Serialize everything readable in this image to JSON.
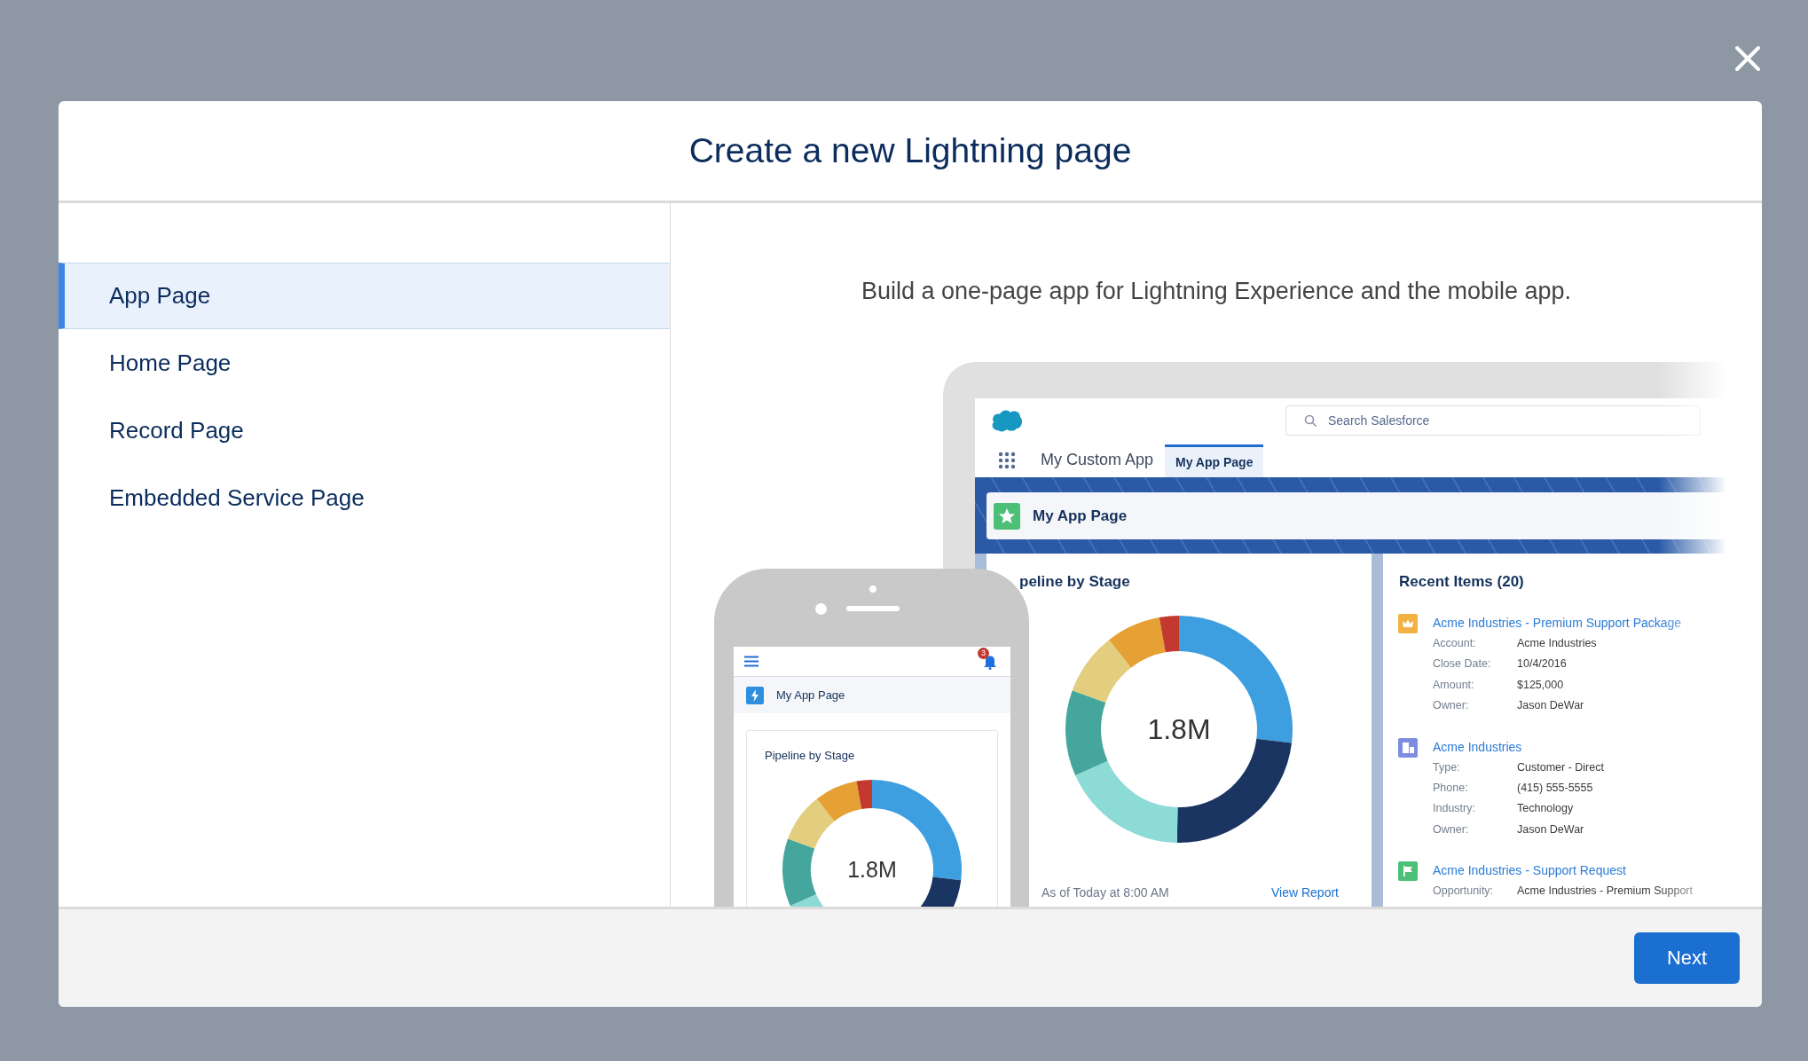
{
  "dialog": {
    "title": "Create a new Lightning page"
  },
  "page_types": [
    {
      "label": "App Page",
      "selected": true
    },
    {
      "label": "Home Page",
      "selected": false
    },
    {
      "label": "Record Page",
      "selected": false
    },
    {
      "label": "Embedded Service Page",
      "selected": false
    }
  ],
  "description": "Build a one-page app for Lightning Experience and the mobile app.",
  "preview": {
    "desktop": {
      "search_placeholder": "Search Salesforce",
      "app_name": "My Custom App",
      "tabs": [
        {
          "label": "My App Page",
          "selected": true
        }
      ],
      "page_title": "My App Page",
      "chart_card": {
        "title": "peline by Stage",
        "total": "1.8M",
        "footnote": "As of Today at 8:00 AM",
        "link": "View Report"
      },
      "recent_items": {
        "title": "Recent Items (20)",
        "items": [
          {
            "kind": "opportunity",
            "title": "Acme Industries - Premium Support Package",
            "fields": [
              {
                "label": "Account:",
                "value": "Acme Industries"
              },
              {
                "label": "Close Date:",
                "value": "10/4/2016"
              },
              {
                "label": "Amount:",
                "value": "$125,000"
              },
              {
                "label": "Owner:",
                "value": "Jason DeWar"
              }
            ]
          },
          {
            "kind": "account",
            "title": "Acme Industries",
            "fields": [
              {
                "label": "Type:",
                "value": "Customer - Direct"
              },
              {
                "label": "Phone:",
                "value": "(415) 555-5555"
              },
              {
                "label": "Industry:",
                "value": "Technology"
              },
              {
                "label": "Owner:",
                "value": "Jason DeWar"
              }
            ]
          },
          {
            "kind": "case",
            "title": "Acme Industries - Support Request",
            "fields": [
              {
                "label": "Opportunity:",
                "value": "Acme Industries - Premium Support"
              }
            ]
          }
        ]
      }
    },
    "mobile": {
      "notification_count": "3",
      "page_title": "My App Page",
      "chart_title": "Pipeline by Stage",
      "total": "1.8M"
    }
  },
  "footer": {
    "next_label": "Next"
  }
}
